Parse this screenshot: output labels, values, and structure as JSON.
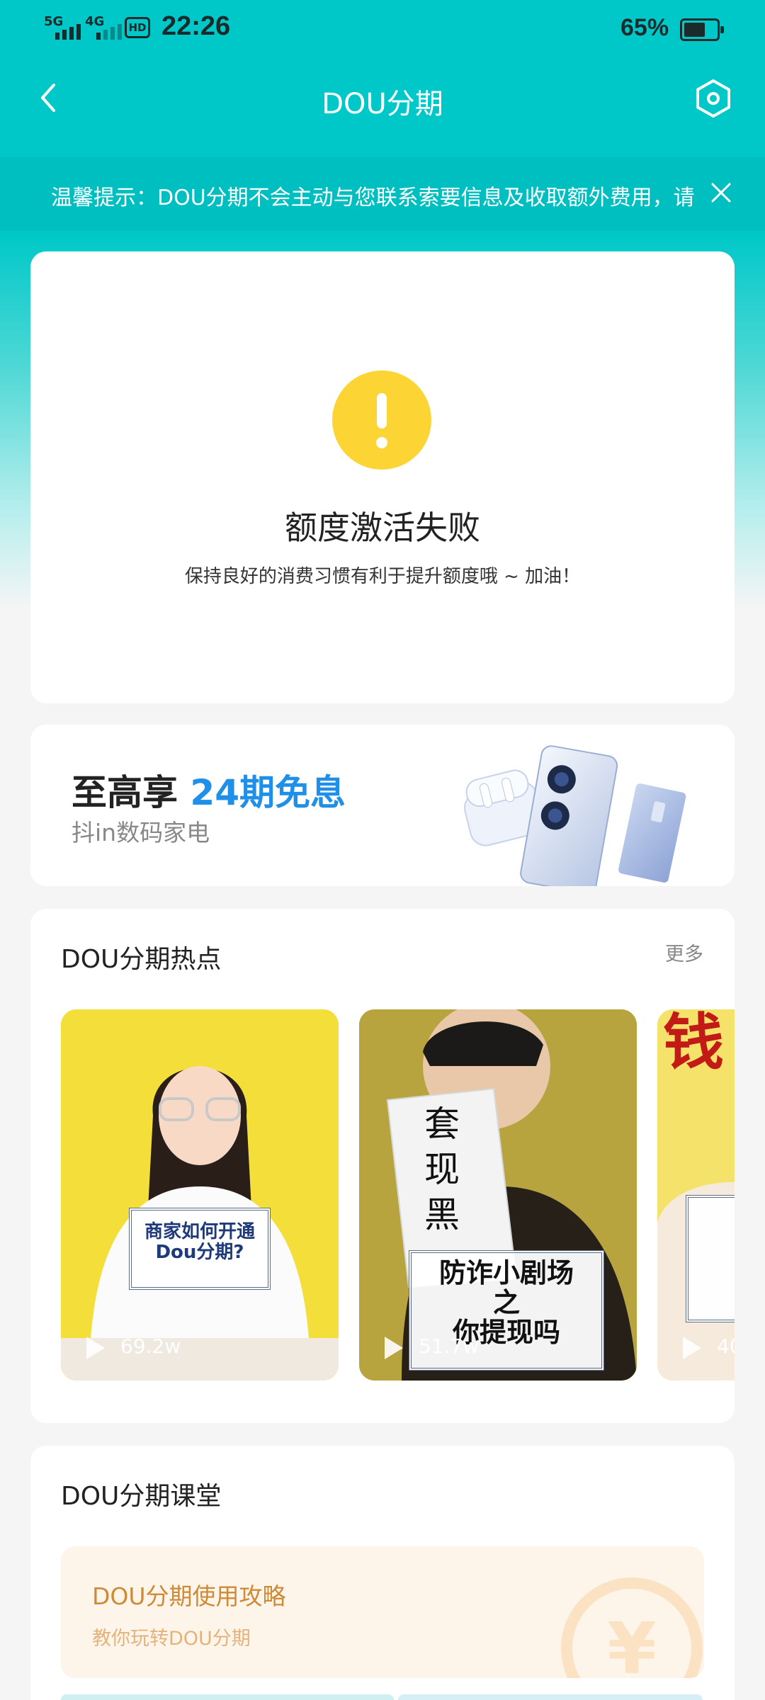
{
  "status_bar": {
    "network_1": "5G",
    "network_2": "4G",
    "hd_badge": "HD",
    "time": "22:26",
    "battery_percent": "65%",
    "battery_level": 0.65
  },
  "nav": {
    "title": "DOU分期",
    "back_icon": "chevron-left-icon",
    "settings_icon": "hexagon-settings-icon"
  },
  "notice": {
    "text": "温馨提示：DOU分期不会主动与您联系索要信息及收取额外费用，请",
    "close_icon": "close-icon"
  },
  "status_card": {
    "icon": "warning-icon",
    "title": "额度激活失败",
    "subtitle": "保持良好的消费习惯有利于提升额度哦 ~ 加油！"
  },
  "promo": {
    "title_prefix": "至高享 ",
    "title_highlight": "24期免息",
    "subtitle": "抖in数码家电"
  },
  "hot": {
    "title": "DOU分期热点",
    "more": "更多",
    "videos": [
      {
        "caption": "商家如何开通\nDou分期?",
        "views": "69.2w"
      },
      {
        "caption": "防诈小剧场\n之\n你提现吗",
        "sign_text": "套现黑",
        "views": "51.7w"
      },
      {
        "caption": "钱",
        "views": "40"
      }
    ]
  },
  "classroom": {
    "title": "DOU分期课堂",
    "guide_title": "DOU分期使用攻略",
    "guide_subtitle": "教你玩转DOU分期",
    "coin_symbol": "¥"
  },
  "colors": {
    "teal": "#00c8c8",
    "warning_yellow": "#fcd534",
    "highlight_blue": "#1f8fe8",
    "guide_orange": "#cf8a35"
  }
}
